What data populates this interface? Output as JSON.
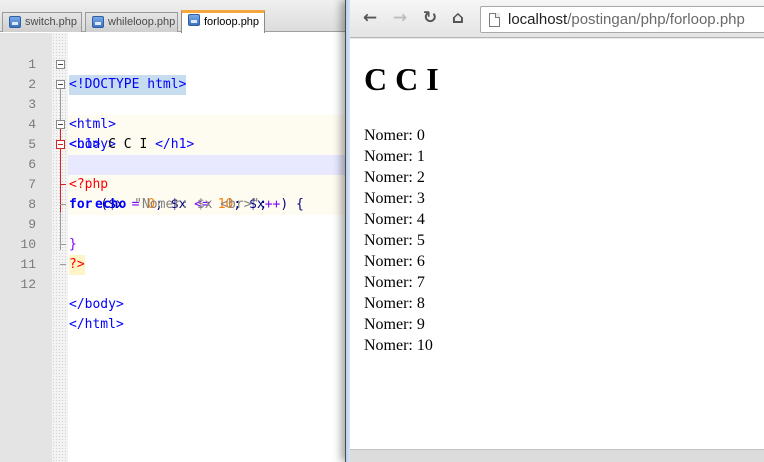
{
  "editor": {
    "tabs": [
      {
        "label": "switch.php"
      },
      {
        "label": "whileloop.php"
      },
      {
        "label": "forloop.php"
      }
    ],
    "line_numbers": [
      "1",
      "2",
      "3",
      "4",
      "5",
      "6",
      "7",
      "8",
      "9",
      "10",
      "11",
      "12"
    ],
    "code": {
      "l1": "<!DOCTYPE html>",
      "l2": "<html>",
      "l3": "<body>",
      "l4_open": "<h1>",
      "l4_text": " C C I ",
      "l4_close": "</h1>",
      "l5": "<?php",
      "l6_for": "for",
      "l6_a": " ($x ",
      "l6_eq": "=",
      "l6_0": " 0",
      "l6_b": "; $x ",
      "l6_le": "<=",
      "l6_10": " 10",
      "l6_c": "; $x",
      "l6_inc": "++",
      "l6_d": ") {",
      "l7_echo": "echo",
      "l7_str": " \"Nomer: $x <br>\"",
      "l7_end": ";",
      "l8": "}",
      "l9": "?>",
      "l11": "</body>",
      "l12": "</html>"
    }
  },
  "browser": {
    "url_host": "localhost",
    "url_path": "/postingan/php/forloop.php",
    "page": {
      "heading": "C C I",
      "lines": [
        "Nomer: 0",
        "Nomer: 1",
        "Nomer: 2",
        "Nomer: 3",
        "Nomer: 4",
        "Nomer: 5",
        "Nomer: 6",
        "Nomer: 7",
        "Nomer: 8",
        "Nomer: 9",
        "Nomer: 10"
      ]
    }
  },
  "icons": {
    "back": "back-arrow-icon",
    "forward": "forward-arrow-icon",
    "reload": "reload-icon",
    "home": "home-icon",
    "page": "page-icon",
    "file": "php-file-icon"
  }
}
